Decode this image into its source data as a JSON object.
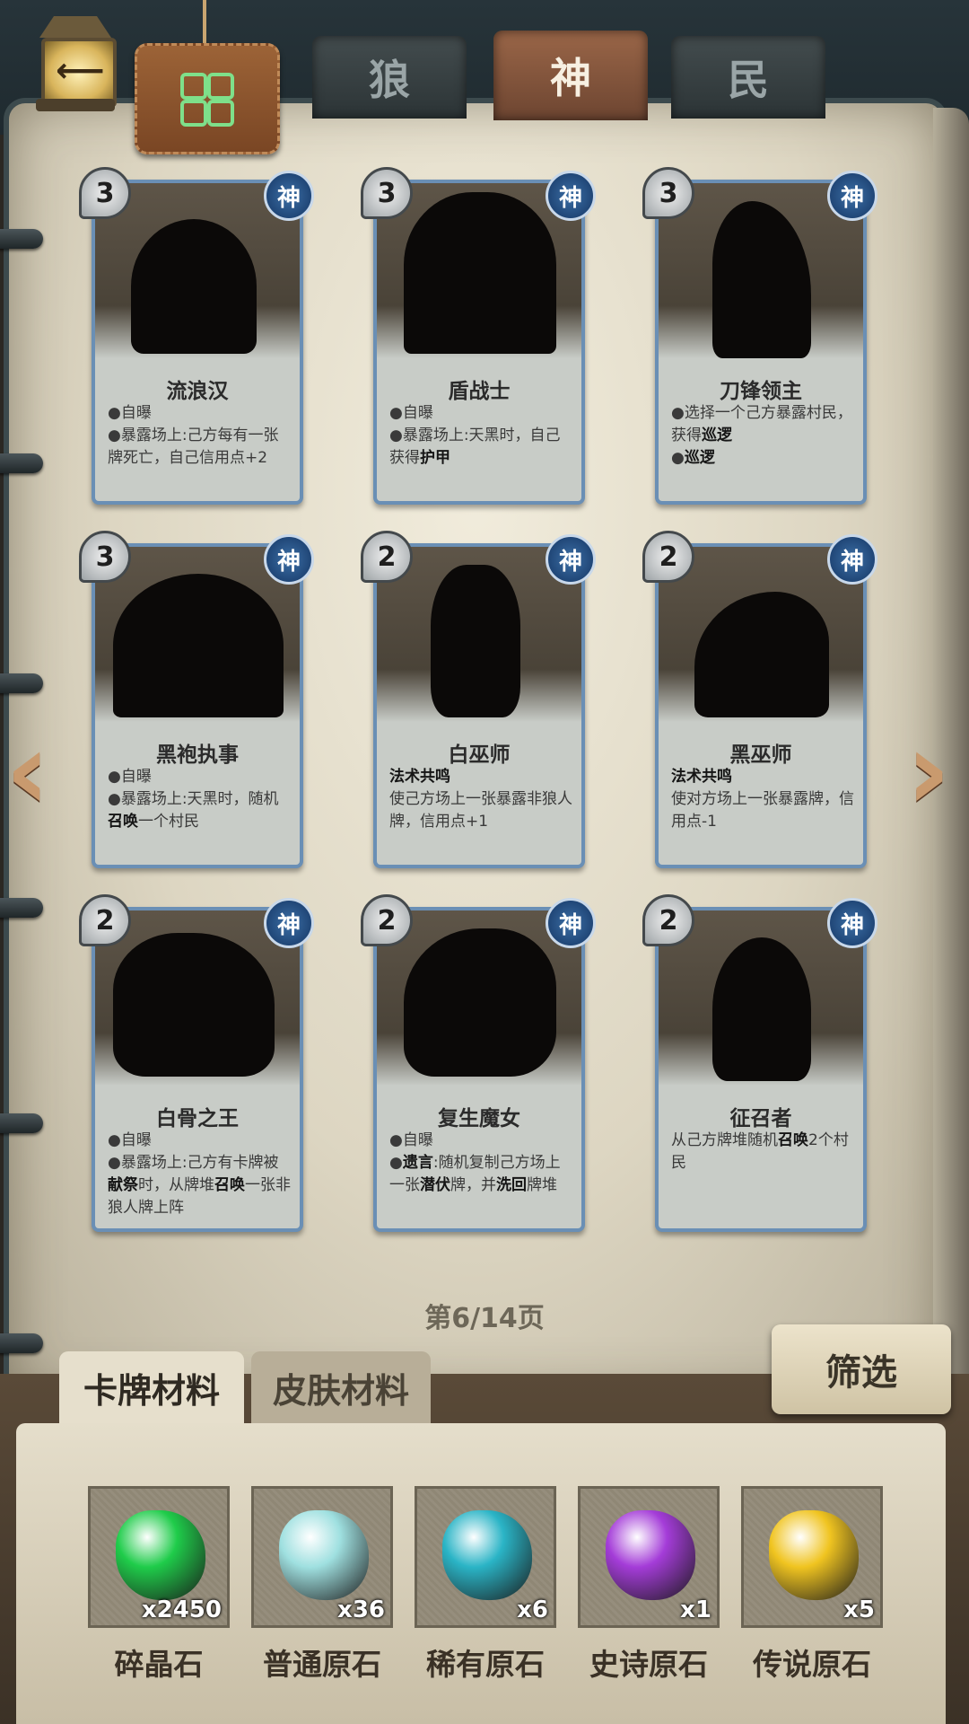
{
  "header": {
    "tabs": [
      {
        "label": "狼"
      },
      {
        "label": "神"
      },
      {
        "label": "民"
      }
    ]
  },
  "cards": [
    {
      "cost": "3",
      "badge": "神",
      "name": "流浪汉",
      "lines": [
        "●自曝",
        "●暴露场上:己方每有一张牌死亡，自己信用点+2"
      ]
    },
    {
      "cost": "3",
      "badge": "神",
      "name": "盾战士",
      "lines": [
        "●自曝",
        "●暴露场上:天黑时，自己获得",
        "护甲"
      ]
    },
    {
      "cost": "3",
      "badge": "神",
      "name": "刀锋领主",
      "lines": [
        "●选择一个己方暴露村民，获得",
        "巡逻",
        "●",
        "巡逻"
      ]
    },
    {
      "cost": "3",
      "badge": "神",
      "name": "黑袍执事",
      "lines": [
        "●自曝",
        "●暴露场上:天黑时，随机",
        "召唤",
        "一个村民"
      ]
    },
    {
      "cost": "2",
      "badge": "神",
      "name": "白巫师",
      "lines": [
        "法术共鸣",
        "使己方场上一张暴露非狼人牌，信用点+1"
      ]
    },
    {
      "cost": "2",
      "badge": "神",
      "name": "黑巫师",
      "lines": [
        "法术共鸣",
        "使对方场上一张暴露牌，信用点-1"
      ]
    },
    {
      "cost": "2",
      "badge": "神",
      "name": "白骨之王",
      "lines": [
        "●自曝",
        "●暴露场上:己方有卡牌被",
        "献祭",
        "时，从牌堆",
        "召唤",
        "一张非狼人牌上阵"
      ]
    },
    {
      "cost": "2",
      "badge": "神",
      "name": "复生魔女",
      "lines": [
        "●自曝",
        "●",
        "遗言",
        ":随机复制己方场上一张",
        "潜伏",
        "牌，并",
        "洗回",
        "牌堆"
      ]
    },
    {
      "cost": "2",
      "badge": "神",
      "name": "征召者",
      "lines": [
        "从己方牌堆随机",
        "召唤",
        "2个村民"
      ]
    }
  ],
  "pagination": {
    "text": "第6/14页"
  },
  "filter": {
    "label": "筛选"
  },
  "material_tabs": [
    {
      "label": "卡牌材料"
    },
    {
      "label": "皮肤材料"
    }
  ],
  "materials": [
    {
      "name": "碎晶石",
      "count": "x2450",
      "color": "#1fcc4a"
    },
    {
      "name": "普通原石",
      "count": "x36",
      "color": "#9fe0e0"
    },
    {
      "name": "稀有原石",
      "count": "x6",
      "color": "#2ab4c6"
    },
    {
      "name": "史诗原石",
      "count": "x1",
      "color": "#a43cd8"
    },
    {
      "name": "传说原石",
      "count": "x5",
      "color": "#f0c420"
    }
  ],
  "icons": {
    "back": "back-arrow-icon",
    "menu": "grid-menu-icon",
    "prev": "chevron-left-icon",
    "next": "chevron-right-icon"
  }
}
